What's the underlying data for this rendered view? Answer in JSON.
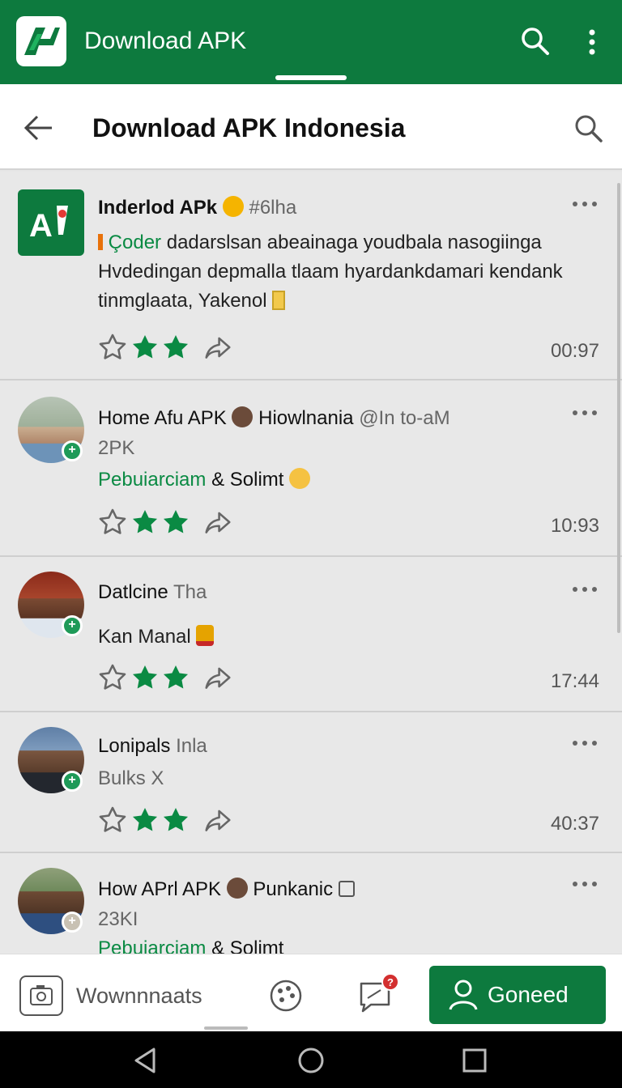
{
  "app": {
    "title": "Download APK",
    "brand_color": "#0d7a3e"
  },
  "subbar": {
    "title": "Download APK Indonesia"
  },
  "posts": [
    {
      "name": "Inderlod APk",
      "handle": "#6lha",
      "line1_tag": "Çoder",
      "line1": "dadarslsan abeainaga youdbala nasogiinga",
      "line2": "Hvdedingan depmalla tlaam hyardankdamari kendank",
      "line3": "tinmglaata, Yakenol",
      "time": "00:97"
    },
    {
      "name": "Home Afu APK",
      "handle_name": "Hiowlnania",
      "handle": "@In to-aM",
      "line1": "2PK",
      "line2_green": "Pebuiarciam",
      "line2_rest": "& Solimt",
      "time": "10:93"
    },
    {
      "name": "Datlcine",
      "handle": "Tha",
      "line1": "Kan Manal",
      "time": "17:44"
    },
    {
      "name": "Lonipals",
      "handle": "Inla",
      "line1": "Bulks X",
      "time": "40:37"
    },
    {
      "name": "How APrl APK",
      "handle_name": "Punkanic",
      "line1": "23KI",
      "line2_green": "Pebuiarciam",
      "line2_rest": "& Solimt"
    }
  ],
  "bottom": {
    "label": "Wownnnaats",
    "cta": "Goneed"
  },
  "icons": {
    "search": "search-icon",
    "more": "more-vert-icon",
    "back": "arrow-left-icon",
    "star_outline": "star-outline-icon",
    "star": "star-icon",
    "share": "share-icon",
    "camera": "camera-icon",
    "palette": "palette-icon",
    "message": "message-icon",
    "user": "user-icon"
  }
}
